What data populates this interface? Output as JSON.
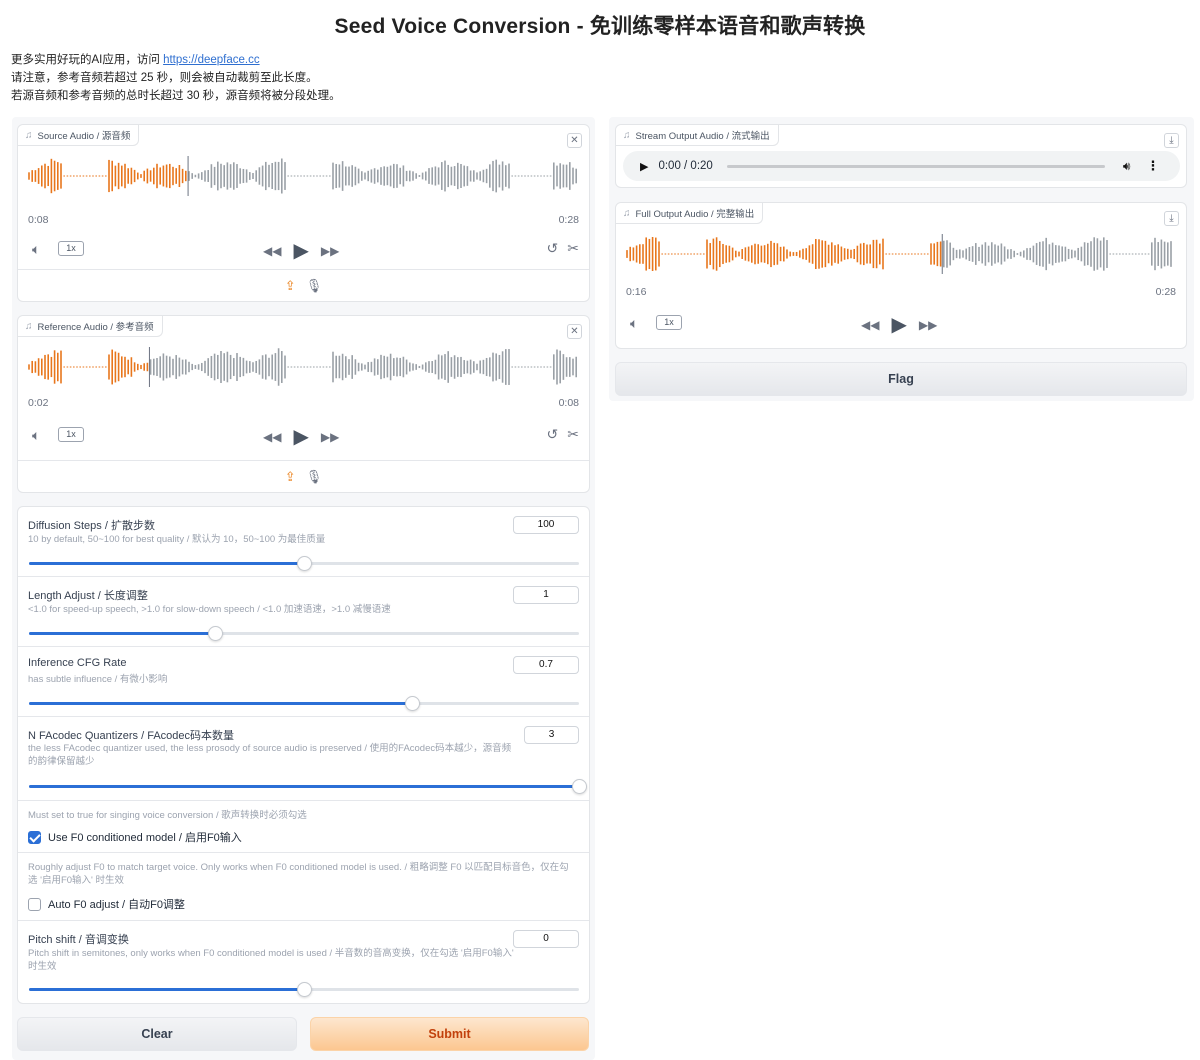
{
  "page": {
    "title": "Seed Voice Conversion - 免训练零样本语音和歌声转换",
    "intro_prefix": "更多实用好玩的AI应用，访问 ",
    "intro_link": "https://deepface.cc",
    "intro_line2": "请注意，参考音频若超过 25 秒，则会被自动裁剪至此长度。",
    "intro_line3": "若源音频和参考音频的总时长超过 30 秒，源音频将被分段处理。"
  },
  "source_audio": {
    "label": "Source Audio / 源音频",
    "current_time": "0:08",
    "duration": "0:28",
    "playback_rate": "1x",
    "progress": 0.29
  },
  "reference_audio": {
    "label": "Reference Audio / 参考音频",
    "current_time": "0:02",
    "duration": "0:08",
    "playback_rate": "1x",
    "progress": 0.22
  },
  "params": {
    "diffusion_steps": {
      "label": "Diffusion Steps / 扩散步数",
      "info": "10 by default, 50~100 for best quality / 默认为 10，50~100 为最佳质量",
      "value": "100",
      "fraction": 0.5
    },
    "length_adjust": {
      "label": "Length Adjust / 长度调整",
      "info": "<1.0 for speed-up speech, >1.0 for slow-down speech / <1.0 加速语速，>1.0 减慢语速",
      "value": "1",
      "fraction": 0.338
    },
    "cfg_rate": {
      "label": "Inference CFG Rate",
      "info": "has subtle influence / 有微小影响",
      "value": "0.7",
      "fraction": 0.697
    },
    "n_quantizers": {
      "label": "N FAcodec Quantizers / FAcodec码本数量",
      "info": "the less FAcodec quantizer used, the less prosody of source audio is preserved / 使用的FAcodec码本越少，源音频的韵律保留越少",
      "value": "3",
      "fraction": 1.0
    },
    "f0_condition": {
      "info": "Must set to true for singing voice conversion / 歌声转换时必须勾选",
      "label": "Use F0 conditioned model / 启用F0输入",
      "checked": true
    },
    "auto_f0": {
      "info": "Roughly adjust F0 to match target voice. Only works when F0 conditioned model is used. / 粗略调整 F0 以匹配目标音色，仅在勾选 '启用F0输入' 时生效",
      "label": "Auto F0 adjust / 自动F0调整",
      "checked": false
    },
    "pitch_shift": {
      "label": "Pitch shift / 音调变换",
      "info": "Pitch shift in semitones, only works when F0 conditioned model is used / 半音数的音高变换，仅在勾选 '启用F0输入' 时生效",
      "value": "0",
      "fraction": 0.5
    }
  },
  "buttons": {
    "clear": "Clear",
    "submit": "Submit",
    "flag": "Flag"
  },
  "stream_output": {
    "label": "Stream Output Audio / 流式输出",
    "time_display": "0:00 / 0:20"
  },
  "full_output": {
    "label": "Full Output Audio / 完整输出",
    "current_time": "0:16",
    "duration": "0:28",
    "playback_rate": "1x",
    "progress": 0.575
  },
  "colors": {
    "wave_played": "#e8761c",
    "wave_unplayed": "#9aa0a6",
    "accent_blue": "#2b6fd6",
    "submit_text": "#c2410c"
  },
  "icons": {
    "music": "music-note-icon",
    "close": "close-icon",
    "download": "download-icon",
    "volume": "volume-icon",
    "rewind": "rewind-icon",
    "play": "play-icon",
    "forward": "fast-forward-icon",
    "undo": "undo-icon",
    "trim": "scissors-icon",
    "upload": "upload-icon",
    "mic": "microphone-icon",
    "more": "more-vertical-icon"
  }
}
